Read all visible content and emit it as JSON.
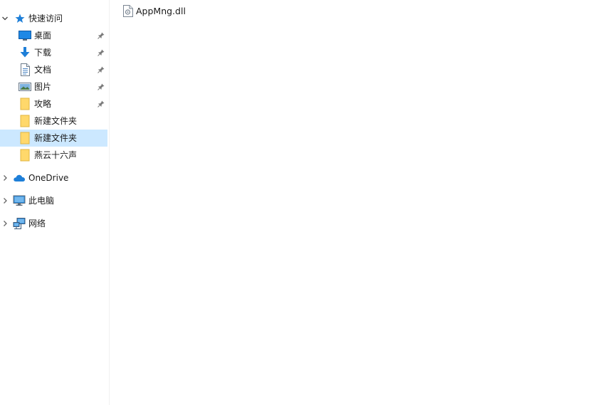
{
  "nav": {
    "quick_access": {
      "label": "快速访问",
      "items": [
        {
          "label": "桌面",
          "icon": "desktop-icon",
          "pinned": true
        },
        {
          "label": "下载",
          "icon": "download-icon",
          "pinned": true
        },
        {
          "label": "文档",
          "icon": "document-icon",
          "pinned": true
        },
        {
          "label": "图片",
          "icon": "pictures-icon",
          "pinned": true
        },
        {
          "label": "攻略",
          "icon": "folder-icon",
          "pinned": true
        },
        {
          "label": "新建文件夹",
          "icon": "folder-icon",
          "pinned": false
        },
        {
          "label": "新建文件夹",
          "icon": "folder-icon",
          "pinned": false,
          "selected": true
        },
        {
          "label": "燕云十六声",
          "icon": "folder-icon",
          "pinned": false
        }
      ]
    },
    "onedrive": {
      "label": "OneDrive",
      "icon": "onedrive-icon"
    },
    "this_pc": {
      "label": "此电脑",
      "icon": "computer-icon"
    },
    "network": {
      "label": "网络",
      "icon": "network-icon"
    }
  },
  "files": [
    {
      "name": "AppMng.dll",
      "icon": "dll-file-icon"
    }
  ],
  "colors": {
    "selection": "#cce8ff",
    "folder": "#ffd86b",
    "accent_blue": "#1e7fd8"
  }
}
